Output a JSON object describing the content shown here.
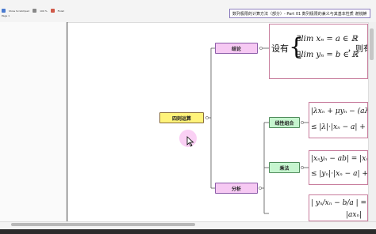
{
  "toolbar": {
    "row1": [
      "Show Scratchpad",
      "100 %",
      "Finish"
    ],
    "row2": [
      "Page 1"
    ]
  },
  "header": {
    "title": "数列极限的计算方法（部分）- Part 01 数列极限的兼义与其基本性质 谢锐麒"
  },
  "nodes": {
    "root": "四则运算",
    "conclusion": "结论",
    "analysis": "分析",
    "linear": "线性组合",
    "product": "乘法"
  },
  "formulas": {
    "conclusion_lead": "设有",
    "conclusion_line1": "∃lim xₙ = a ∈ ℝ",
    "conclusion_line2": "∃lim yₙ = b ∈ ℝ",
    "conclusion_tail": "，则有",
    "linear_line1": "|λxₙ + μyₙ − (aλ + μ",
    "linear_line2": "≤ |λ|·|xₙ − a| + |μ|·",
    "product_line1": "|xₙyₙ − ab| = |xₙyₙ",
    "product_line2": "≤ |yₙ|·|xₙ − a| + |a|",
    "quotient_line1": "| yₙ/xₙ − b/a | = | (yₙa − b",
    "quotient_line2": "|axₙ|"
  },
  "colors": {
    "pink_node": "#f6c9f3",
    "yellow_node": "#fff37a",
    "green_node": "#c6f5cf",
    "box_border": "#c77c9c",
    "title_border": "#8e7fbf"
  }
}
